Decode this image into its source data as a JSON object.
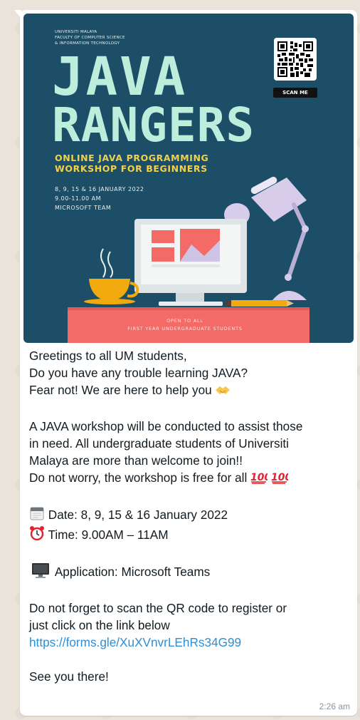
{
  "poster": {
    "university_lines": [
      "UNIVERSITI MALAYA",
      "FACULTY OF COMPUTER SCIENCE",
      "& INFORMATION TECHNOLOGY"
    ],
    "title_line1": "JAVA",
    "title_line2": "RANGERS",
    "subtitle_line1": "ONLINE JAVA PROGRAMMING",
    "subtitle_line2": "WORKSHOP FOR BEGINNERS",
    "info_lines": [
      "8, 9, 15 & 16 JANUARY 2022",
      "9.00-11.00 AM",
      "MICROSOFT TEAM"
    ],
    "scan_label": "SCAN ME",
    "footer_line1": "OPEN TO ALL",
    "footer_line2": "FIRST YEAR UNDERGRADUATE STUDENTS",
    "colors": {
      "background": "#1d4e67",
      "title": "#bdeedc",
      "subtitle": "#f2d14a",
      "desk": "#f46a66"
    }
  },
  "message": {
    "greeting": "Greetings to all UM students,",
    "question": "Do you have any trouble learning JAVA?",
    "reassure": "Fear not! We are here to help you",
    "para_line1": "A JAVA workshop will be conducted to assist those",
    "para_line2": "in need. All undergraduate students of Universiti",
    "para_line3": "Malaya are more than welcome to join!!",
    "para_line4": "Do not worry, the workshop is free for all",
    "date": "Date: 8, 9, 15 & 16 January 2022",
    "time_text": "Time: 9.00AM – 11AM",
    "application": "Application: Microsoft Teams",
    "register_line1": "Do not forget to scan the QR code to register or",
    "register_line2": "just click on the link below",
    "link": "https://forms.gle/XuXVnvrLEhRs34G99",
    "closing": "See you there!",
    "timestamp": "2:26 am"
  },
  "icons": [
    "handshake-icon",
    "hundred-points-icon",
    "calendar-icon",
    "alarm-clock-icon",
    "desktop-computer-icon"
  ]
}
